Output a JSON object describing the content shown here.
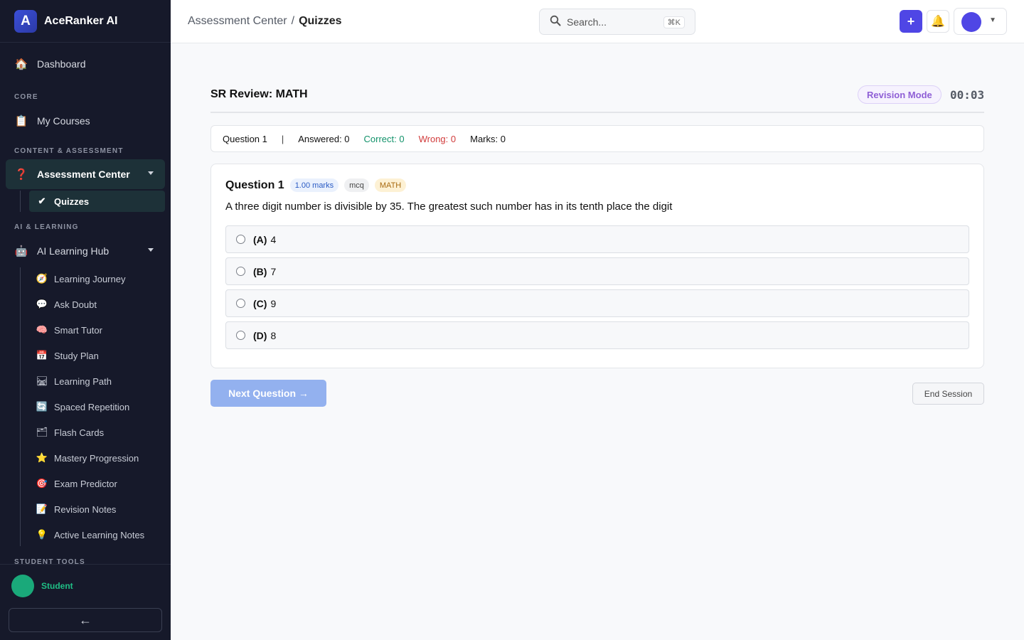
{
  "brand": {
    "name": "AceRanker AI",
    "logo_glyph": "A"
  },
  "sidebar": {
    "dashboard": {
      "icon": "🏠",
      "label": "Dashboard"
    },
    "sections": {
      "core": "CORE",
      "content": "CONTENT & ASSESSMENT",
      "ai": "AI & LEARNING",
      "student": "STUDENT TOOLS"
    },
    "my_courses": {
      "icon": "📋",
      "label": "My Courses"
    },
    "assessment_center": {
      "icon": "❓",
      "label": "Assessment Center"
    },
    "quizzes": {
      "icon": "✔",
      "label": "Quizzes"
    },
    "ai_hub": {
      "icon": "🤖",
      "label": "AI Learning Hub"
    },
    "ai_items": [
      {
        "icon": "🧭",
        "label": "Learning Journey"
      },
      {
        "icon": "💬",
        "label": "Ask Doubt"
      },
      {
        "icon": "🧠",
        "label": "Smart Tutor"
      },
      {
        "icon": "📅",
        "label": "Study Plan"
      },
      {
        "icon": "🛤",
        "label": "Learning Path"
      },
      {
        "icon": "🔄",
        "label": "Spaced Repetition"
      },
      {
        "icon": "🗂",
        "label": "Flash Cards"
      },
      {
        "icon": "⭐",
        "label": "Mastery Progression"
      },
      {
        "icon": "🎯",
        "label": "Exam Predictor"
      },
      {
        "icon": "📝",
        "label": "Revision Notes"
      },
      {
        "icon": "💡",
        "label": "Active Learning Notes"
      }
    ],
    "user_label": "Student",
    "collapse_glyph": "←"
  },
  "topbar": {
    "breadcrumb": {
      "parent": "Assessment Center",
      "separator": "/",
      "current": "Quizzes"
    },
    "search": {
      "placeholder": "Search...",
      "shortcut": "⌘K"
    },
    "plus_glyph": "+",
    "bell_glyph": "🔔",
    "dropdown_glyph": "▼"
  },
  "session": {
    "title": "SR Review: MATH",
    "mode": "Revision Mode",
    "timer": "00:03"
  },
  "stats": {
    "question": "Question 1",
    "divider": "|",
    "answered": "Answered: 0",
    "correct": "Correct: 0",
    "wrong": "Wrong: 0",
    "marks": "Marks: 0"
  },
  "question": {
    "number": "Question 1",
    "marks": "1.00 marks",
    "type": "mcq",
    "subject": "MATH",
    "text": "A three digit number is divisible by 35. The greatest such number has in its tenth place the digit",
    "options": [
      {
        "label": "(A)",
        "value": "4"
      },
      {
        "label": "(B)",
        "value": "7"
      },
      {
        "label": "(C)",
        "value": "9"
      },
      {
        "label": "(D)",
        "value": "8"
      }
    ]
  },
  "actions": {
    "next": "Next Question →",
    "end": "End Session"
  },
  "colors": {
    "sidebar_bg": "#16192a",
    "accent": "#4f46e5",
    "correct": "#12926a",
    "wrong": "#d13b3b",
    "mode": "#8f5fd6"
  }
}
